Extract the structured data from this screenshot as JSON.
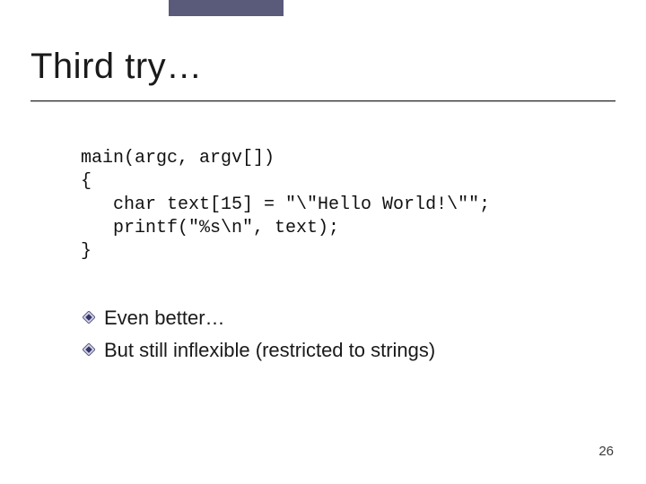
{
  "title": "Third try…",
  "code": {
    "l1": "main(argc, argv[])",
    "l2": "{",
    "l3": "   char text[15] = \"\\\"Hello World!\\\"\";",
    "l4": "   printf(\"%s\\n\", text);",
    "l5": "}"
  },
  "bullets": [
    "Even better…",
    "But still inflexible (restricted to strings)"
  ],
  "page_number": "26"
}
